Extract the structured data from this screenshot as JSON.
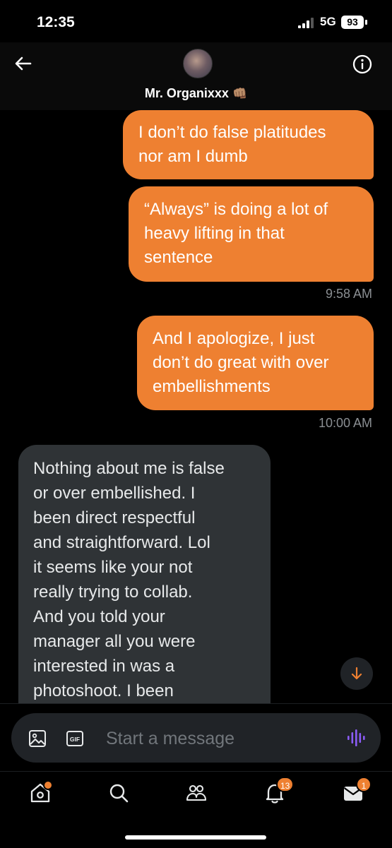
{
  "status_bar": {
    "time": "12:35",
    "network": "5G",
    "battery": "93"
  },
  "header": {
    "contact_name": "Mr. Organixxx",
    "contact_emoji": "👊🏽"
  },
  "messages": [
    {
      "direction": "outgoing",
      "lines": [
        "I don’t do false platitudes",
        "nor am I dumb"
      ]
    },
    {
      "direction": "outgoing",
      "lines": [
        "“Always” is doing a lot of",
        "heavy lifting in that",
        "sentence"
      ]
    },
    {
      "timestamp": "9:58 AM"
    },
    {
      "direction": "outgoing",
      "lines": [
        "And I apologize, I just",
        "don’t do great with over",
        "embellishments"
      ]
    },
    {
      "timestamp": "10:00 AM"
    },
    {
      "direction": "incoming",
      "lines": [
        "Nothing about me is false",
        "or over embellished. I",
        "been direct respectful",
        "and straightforward. Lol",
        "it seems like your not",
        "really trying to collab.",
        "And you told your",
        "manager all you were",
        "interested in was a",
        "photoshoot. I been"
      ]
    }
  ],
  "composer": {
    "placeholder": "Start a message",
    "gif_label": "GIF"
  },
  "tabbar": {
    "items": [
      "home",
      "search",
      "communities",
      "notifications",
      "messages"
    ],
    "notifications_badge": "13",
    "messages_badge": "1"
  },
  "colors": {
    "accent": "#ee8031",
    "incoming_bubble": "#2f3336",
    "voice": "#8b5cf6"
  }
}
